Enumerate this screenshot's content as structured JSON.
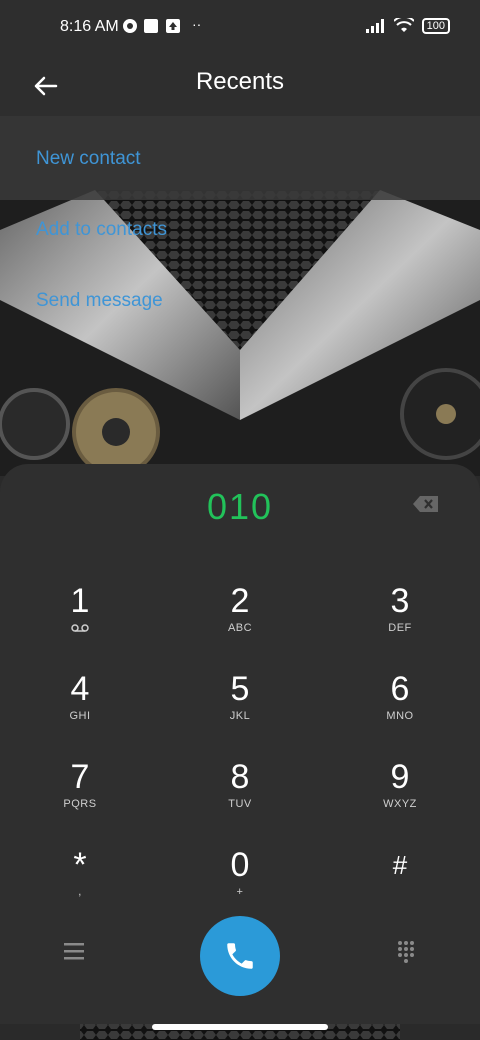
{
  "status": {
    "time": "8:16 AM",
    "battery": "100"
  },
  "header": {
    "title": "Recents"
  },
  "actions": {
    "new_contact": "New contact",
    "add_to_contacts": "Add to contacts",
    "send_message": "Send message"
  },
  "dialer": {
    "number": "010",
    "keys": [
      {
        "digit": "1",
        "letters": ""
      },
      {
        "digit": "2",
        "letters": "ABC"
      },
      {
        "digit": "3",
        "letters": "DEF"
      },
      {
        "digit": "4",
        "letters": "GHI"
      },
      {
        "digit": "5",
        "letters": "JKL"
      },
      {
        "digit": "6",
        "letters": "MNO"
      },
      {
        "digit": "7",
        "letters": "PQRS"
      },
      {
        "digit": "8",
        "letters": "TUV"
      },
      {
        "digit": "9",
        "letters": "WXYZ"
      },
      {
        "digit": "*",
        "letters": ","
      },
      {
        "digit": "0",
        "letters": "+"
      },
      {
        "digit": "#",
        "letters": ""
      }
    ]
  },
  "colors": {
    "accent_blue": "#2b9ad8",
    "number_green": "#22c25a",
    "action_blue": "#3f95d6"
  }
}
